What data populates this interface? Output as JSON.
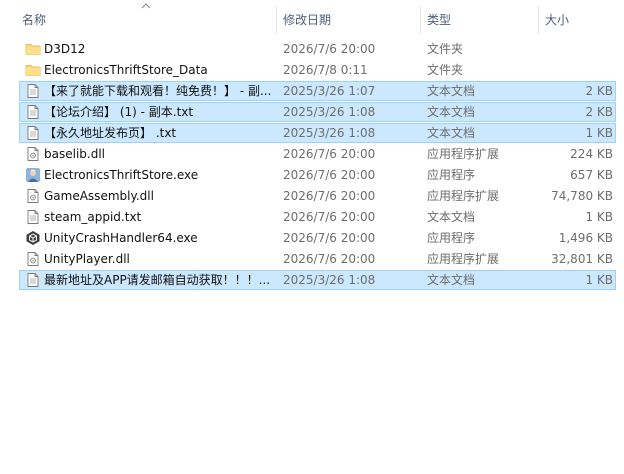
{
  "columns": {
    "name": "名称",
    "date": "修改日期",
    "type": "类型",
    "size": "大小"
  },
  "files": [
    {
      "name": "D3D12",
      "date": "2026/7/6 20:00",
      "type": "文件夹",
      "size": "",
      "icon": "folder-icon",
      "selected": false
    },
    {
      "name": "ElectronicsThriftStore_Data",
      "date": "2026/7/8 0:11",
      "type": "文件夹",
      "size": "",
      "icon": "folder-icon",
      "selected": false
    },
    {
      "name": "【来了就能下载和观看！纯免费！】 - 副...",
      "date": "2025/3/26 1:07",
      "type": "文本文档",
      "size": "2 KB",
      "icon": "text-file-icon",
      "selected": true
    },
    {
      "name": "【论坛介绍】 (1) - 副本.txt",
      "date": "2025/3/26 1:08",
      "type": "文本文档",
      "size": "2 KB",
      "icon": "text-file-icon",
      "selected": true
    },
    {
      "name": "【永久地址发布页】 .txt",
      "date": "2025/3/26 1:08",
      "type": "文本文档",
      "size": "1 KB",
      "icon": "text-file-icon",
      "selected": true
    },
    {
      "name": "baselib.dll",
      "date": "2026/7/6 20:00",
      "type": "应用程序扩展",
      "size": "224 KB",
      "icon": "dll-file-icon",
      "selected": false
    },
    {
      "name": "ElectronicsThriftStore.exe",
      "date": "2026/7/6 20:00",
      "type": "应用程序",
      "size": "657 KB",
      "icon": "game-app-icon",
      "selected": false
    },
    {
      "name": "GameAssembly.dll",
      "date": "2026/7/6 20:00",
      "type": "应用程序扩展",
      "size": "74,780 KB",
      "icon": "dll-file-icon",
      "selected": false
    },
    {
      "name": "steam_appid.txt",
      "date": "2026/7/6 20:00",
      "type": "文本文档",
      "size": "1 KB",
      "icon": "text-file-icon",
      "selected": false
    },
    {
      "name": "UnityCrashHandler64.exe",
      "date": "2026/7/6 20:00",
      "type": "应用程序",
      "size": "1,496 KB",
      "icon": "unity-app-icon",
      "selected": false
    },
    {
      "name": "UnityPlayer.dll",
      "date": "2026/7/6 20:00",
      "type": "应用程序扩展",
      "size": "32,801 KB",
      "icon": "dll-file-icon",
      "selected": false
    },
    {
      "name": "最新地址及APP请发邮箱自动获取！！！...",
      "date": "2025/3/26 1:08",
      "type": "文本文档",
      "size": "1 KB",
      "icon": "text-file-icon",
      "selected": true
    }
  ]
}
